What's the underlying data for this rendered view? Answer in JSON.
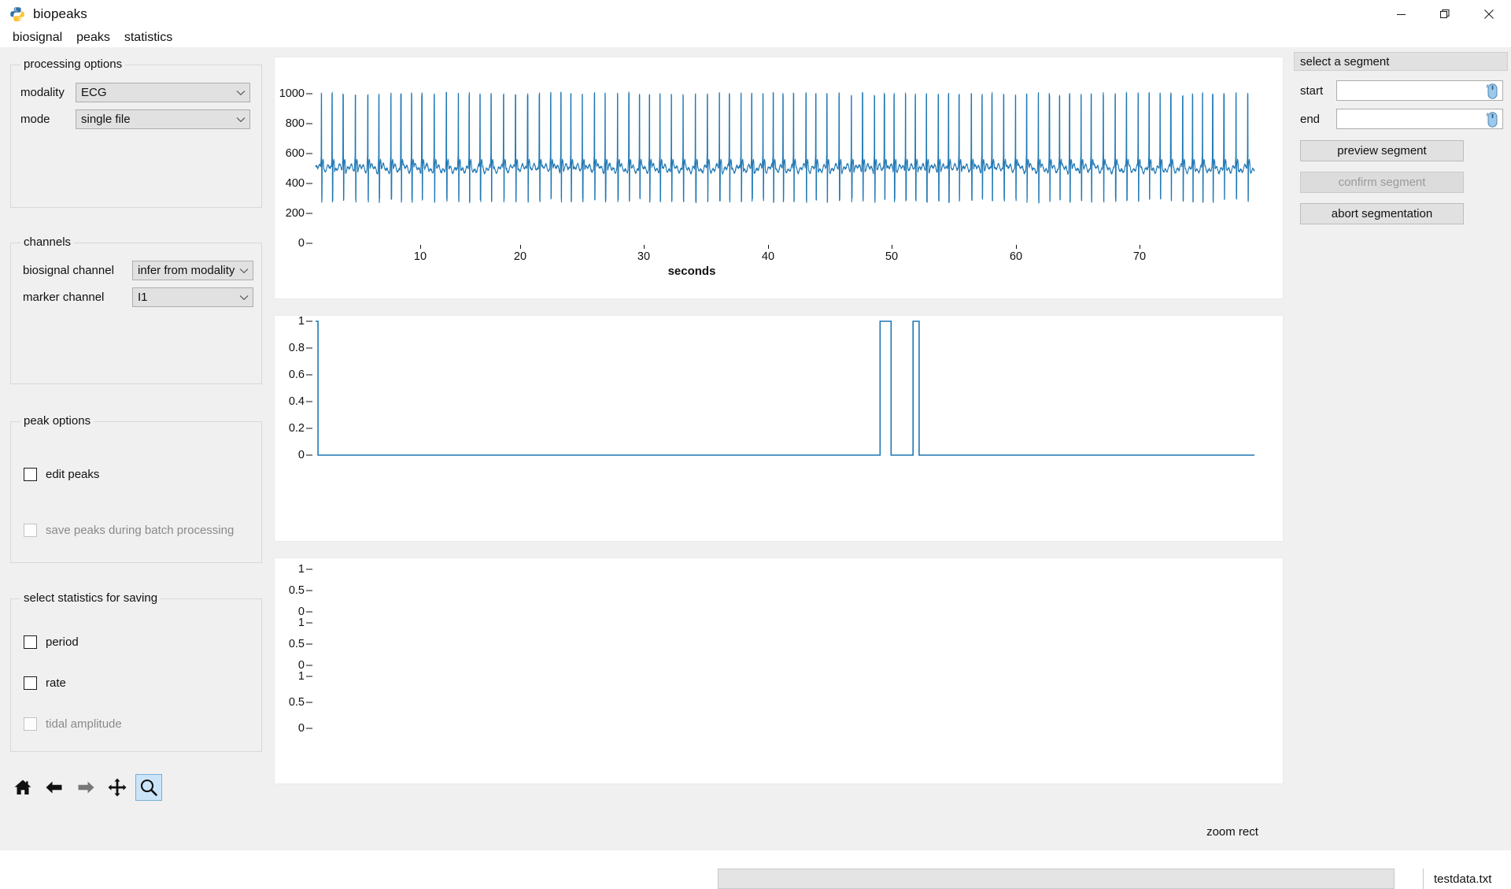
{
  "window": {
    "title": "biopeaks",
    "app_icon": "python-icon",
    "controls": [
      {
        "name": "minimize-button",
        "glyph": "minimize-icon"
      },
      {
        "name": "restore-button",
        "glyph": "restore-icon"
      },
      {
        "name": "close-button",
        "glyph": "close-icon"
      }
    ]
  },
  "menubar": {
    "items": [
      {
        "label": "biosignal",
        "name": "menu-biosignal"
      },
      {
        "label": "peaks",
        "name": "menu-peaks"
      },
      {
        "label": "statistics",
        "name": "menu-statistics"
      }
    ]
  },
  "processing_options": {
    "title": "processing options",
    "modality": {
      "label": "modality",
      "value": "ECG"
    },
    "mode": {
      "label": "mode",
      "value": "single file"
    }
  },
  "channels": {
    "title": "channels",
    "biosignal_channel": {
      "label": "biosignal channel",
      "value": "infer from modality"
    },
    "marker_channel": {
      "label": "marker channel",
      "value": "I1"
    }
  },
  "peak_options": {
    "title": "peak options",
    "edit_peaks": {
      "label": "edit peaks",
      "checked": false,
      "enabled": true
    },
    "save_peaks_batch": {
      "label": "save peaks during batch processing",
      "checked": false,
      "enabled": false
    }
  },
  "statistics_options": {
    "title": "select statistics for saving",
    "items": [
      {
        "label": "period",
        "checked": false,
        "enabled": true
      },
      {
        "label": "rate",
        "checked": false,
        "enabled": true
      },
      {
        "label": "tidal amplitude",
        "checked": false,
        "enabled": false
      }
    ]
  },
  "navigation_toolbar": {
    "buttons": [
      {
        "name": "home-icon",
        "label": "home",
        "active": false,
        "enabled": true
      },
      {
        "name": "back-arrow-icon",
        "label": "back",
        "active": false,
        "enabled": true
      },
      {
        "name": "forward-arrow-icon",
        "label": "forward",
        "active": false,
        "enabled": false
      },
      {
        "name": "pan-move-icon",
        "label": "pan",
        "active": false,
        "enabled": true
      },
      {
        "name": "zoom-magnifier-icon",
        "label": "zoom",
        "active": true,
        "enabled": true
      }
    ]
  },
  "segment_panel": {
    "header": "select a segment",
    "start": {
      "label": "start",
      "value": "",
      "icon": "mouse-cursor-icon"
    },
    "end": {
      "label": "end",
      "value": "",
      "icon": "mouse-cursor-icon"
    },
    "buttons": [
      {
        "label": "preview segment",
        "name": "preview-segment-button",
        "enabled": true
      },
      {
        "label": "confirm segment",
        "name": "confirm-segment-button",
        "enabled": false
      },
      {
        "label": "abort segmentation",
        "name": "abort-segmentation-button",
        "enabled": true
      }
    ]
  },
  "statusbar": {
    "message": "zoom rect",
    "progress_value": "",
    "file_label": "testdata.txt"
  },
  "chart_data": [
    {
      "type": "line",
      "name": "biosignal-plot",
      "title": "",
      "xlabel": "seconds",
      "ylabel": "",
      "xticks": [
        10,
        20,
        30,
        40,
        50,
        60,
        70
      ],
      "yticks": [
        0,
        200,
        400,
        600,
        800,
        1000
      ],
      "xlim": [
        0,
        77
      ],
      "ylim": [
        0,
        1080
      ],
      "grid": false,
      "legend": "none",
      "series": [
        {
          "name": "ECG",
          "color": "#1f77b4",
          "description": "ECG waveform, baseline ~500 with R-peaks reaching ~1000 and S-troughs near ~260, about 85 beats over 77 seconds"
        }
      ]
    },
    {
      "type": "line",
      "name": "marker-plot",
      "title": "",
      "xlabel": "",
      "ylabel": "",
      "xticks": [],
      "yticks": [
        0.0,
        0.2,
        0.4,
        0.6,
        0.8,
        1.0
      ],
      "xlim": [
        0,
        77
      ],
      "ylim": [
        -0.05,
        1.05
      ],
      "grid": false,
      "legend": "none",
      "series": [
        {
          "name": "I1 marker",
          "color": "#1f77b4",
          "description": "square-wave marker channel: high at t=0, drops to 0 immediately, two narrow pulses to 1.0 near t=46.5-47.5 and t=49-49.5, then 0 until end",
          "points": [
            {
              "x": 0,
              "y": 1.0
            },
            {
              "x": 0.2,
              "y": 1.0
            },
            {
              "x": 0.2,
              "y": 0.0
            },
            {
              "x": 46.3,
              "y": 0.0
            },
            {
              "x": 46.3,
              "y": 1.0
            },
            {
              "x": 47.2,
              "y": 1.0
            },
            {
              "x": 47.2,
              "y": 0.0
            },
            {
              "x": 49.0,
              "y": 0.0
            },
            {
              "x": 49.0,
              "y": 1.0
            },
            {
              "x": 49.5,
              "y": 1.0
            },
            {
              "x": 49.5,
              "y": 0.0
            },
            {
              "x": 77,
              "y": 0.0
            }
          ]
        }
      ]
    },
    {
      "type": "line",
      "name": "statistics-plot",
      "title": "",
      "xlabel": "",
      "ylabel": "",
      "xticks": [],
      "subplots": [
        {
          "name": "period-axis",
          "yticks": [
            0.0,
            0.5,
            1.0
          ],
          "series": []
        },
        {
          "name": "rate-axis",
          "yticks": [
            0.0,
            0.5,
            1.0
          ],
          "series": []
        },
        {
          "name": "tidal-amplitude-axis",
          "yticks": [
            0.0,
            0.5,
            1.0
          ],
          "series": []
        }
      ],
      "grid": false,
      "legend": "none",
      "series": []
    }
  ],
  "colors": {
    "trace": "#1f77b4",
    "panel_bg": "#f0f0f0",
    "plot_bg": "#ffffff",
    "active_tool": "#cce4f7"
  }
}
